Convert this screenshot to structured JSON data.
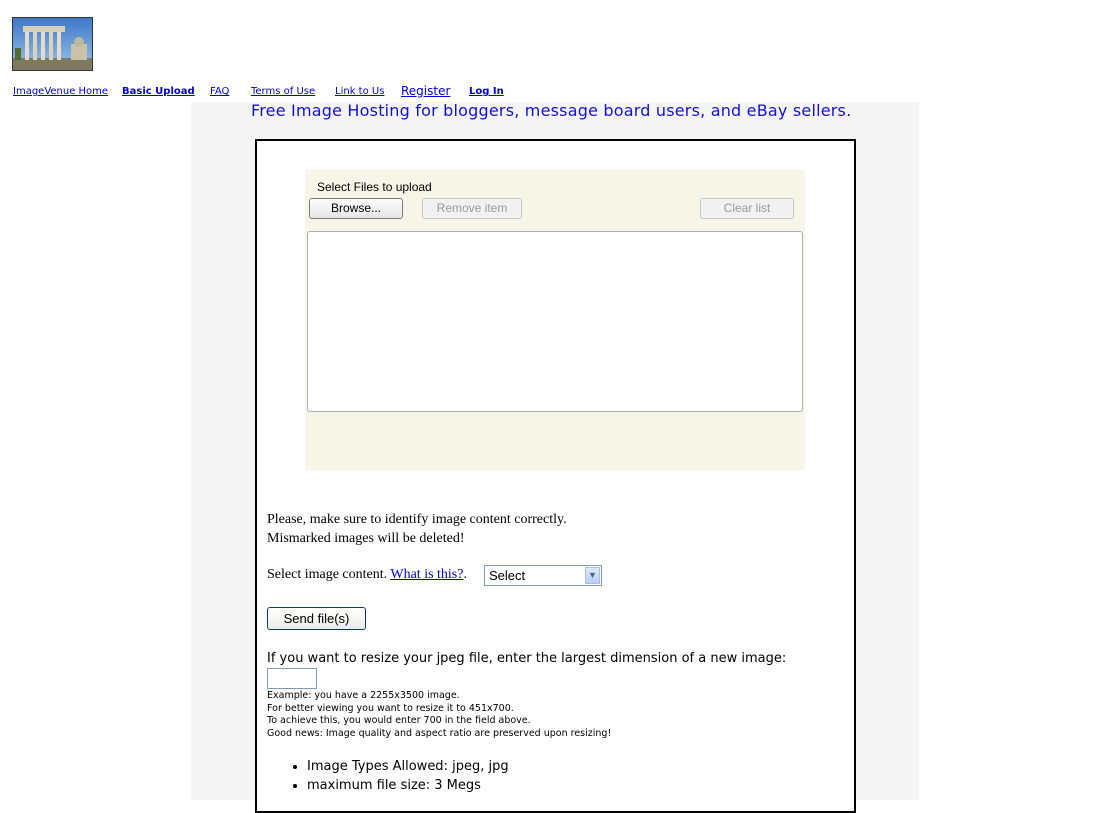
{
  "nav": {
    "home": "ImageVenue Home",
    "basic_upload": "Basic Upload",
    "faq": "FAQ",
    "terms": "Terms of Use",
    "link": "Link to Us",
    "register": "Register",
    "login": "Log In"
  },
  "tagline": "Free Image Hosting for bloggers, message board users, and eBay sellers.",
  "uploader": {
    "title": "Select Files to upload",
    "browse": "Browse...",
    "remove": "Remove item",
    "clear": "Clear list"
  },
  "notice": {
    "line1": "Please, make sure to identify image content correctly.",
    "line2": "Mismarked images will be deleted!"
  },
  "content_select": {
    "label": "Select image content.",
    "link": "What is this?",
    "after_link": ".",
    "value": "Select"
  },
  "send_button": "Send file(s)",
  "resize": {
    "label": "If you want to resize your jpeg file, enter the largest dimension of a new image:",
    "example": [
      "Example: you have a 2255x3500 image.",
      "For better viewing you want to resize it to 451x700.",
      "To achieve this, you would enter 700 in the field above.",
      "Good news: Image quality and aspect ratio are preserved upon resizing!"
    ]
  },
  "rules": [
    "Image Types Allowed: jpeg, jpg",
    "maximum file size: 3 Megs"
  ]
}
